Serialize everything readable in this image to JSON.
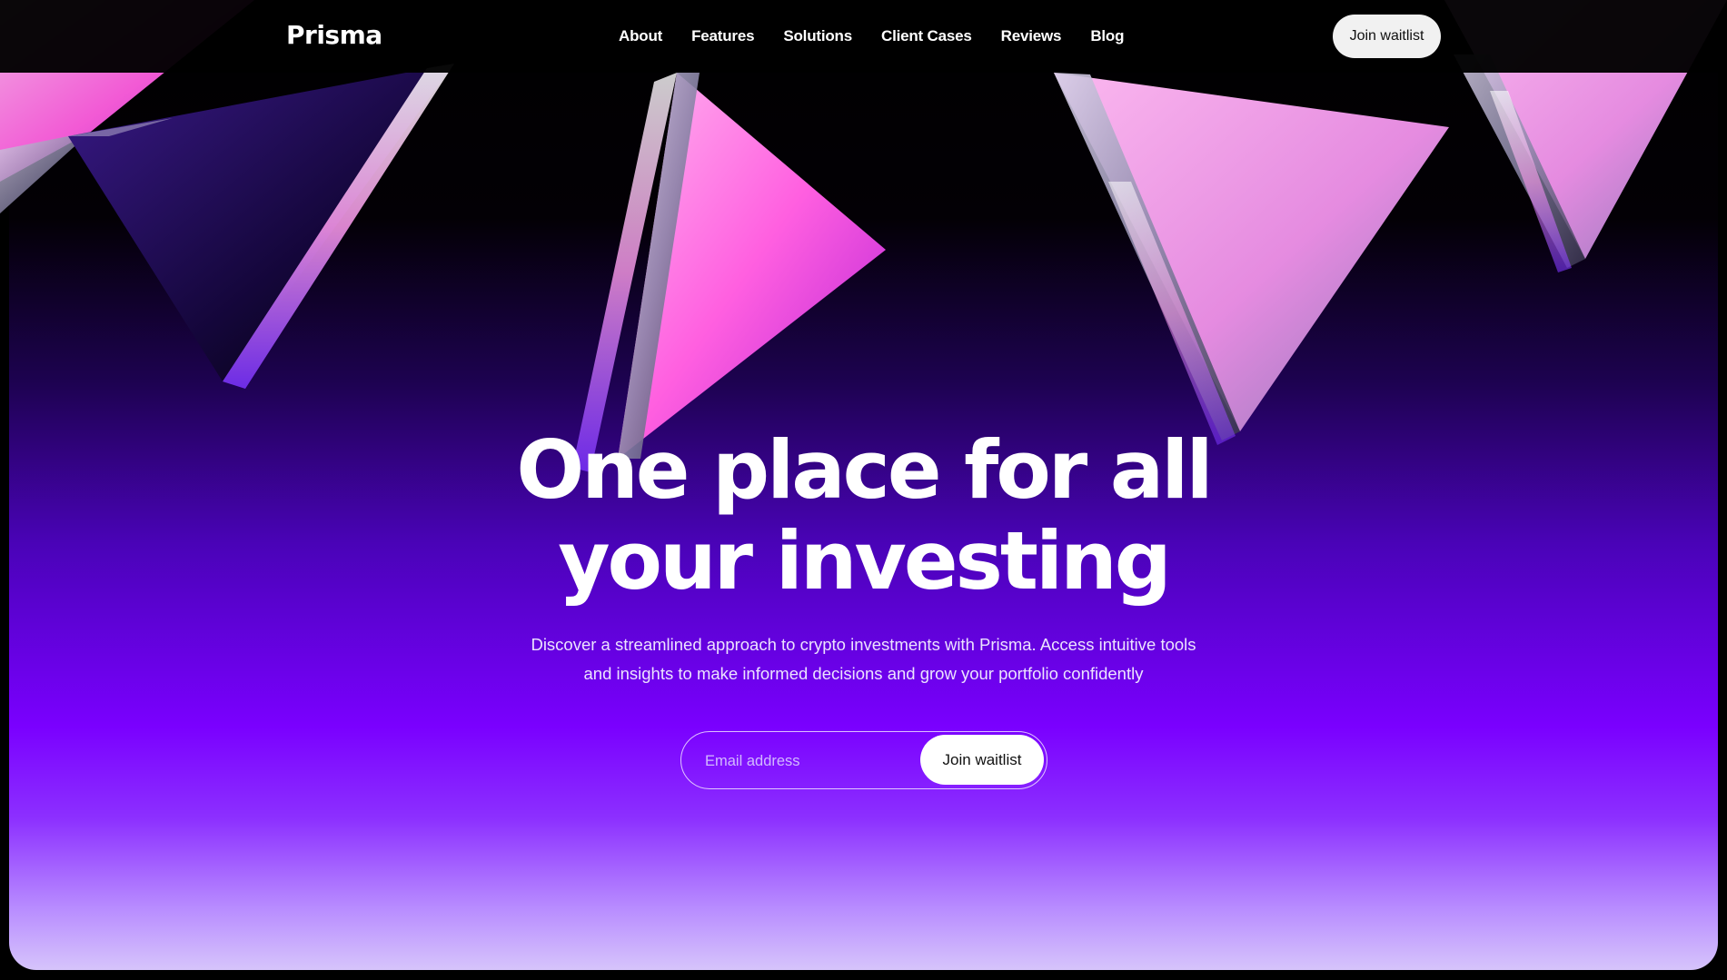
{
  "brand": {
    "name": "Prisma"
  },
  "nav": {
    "links": [
      {
        "label": "About"
      },
      {
        "label": "Features"
      },
      {
        "label": "Solutions"
      },
      {
        "label": "Client Cases"
      },
      {
        "label": "Reviews"
      },
      {
        "label": "Blog"
      }
    ],
    "cta_label": "Join waitlist"
  },
  "hero": {
    "headline_line1": "One place for all",
    "headline_line2": "your investing",
    "subtitle_line1": "Discover a streamlined approach to crypto investments with Prisma. Access intuitive tools",
    "subtitle_line2": "and insights to make informed decisions and grow your portfolio confidently",
    "email_placeholder": "Email address",
    "email_value": "",
    "cta_label": "Join waitlist"
  },
  "colors": {
    "accent_purple": "#7a00ff",
    "prism_pink": "#ff7ae6",
    "background": "#000000"
  }
}
